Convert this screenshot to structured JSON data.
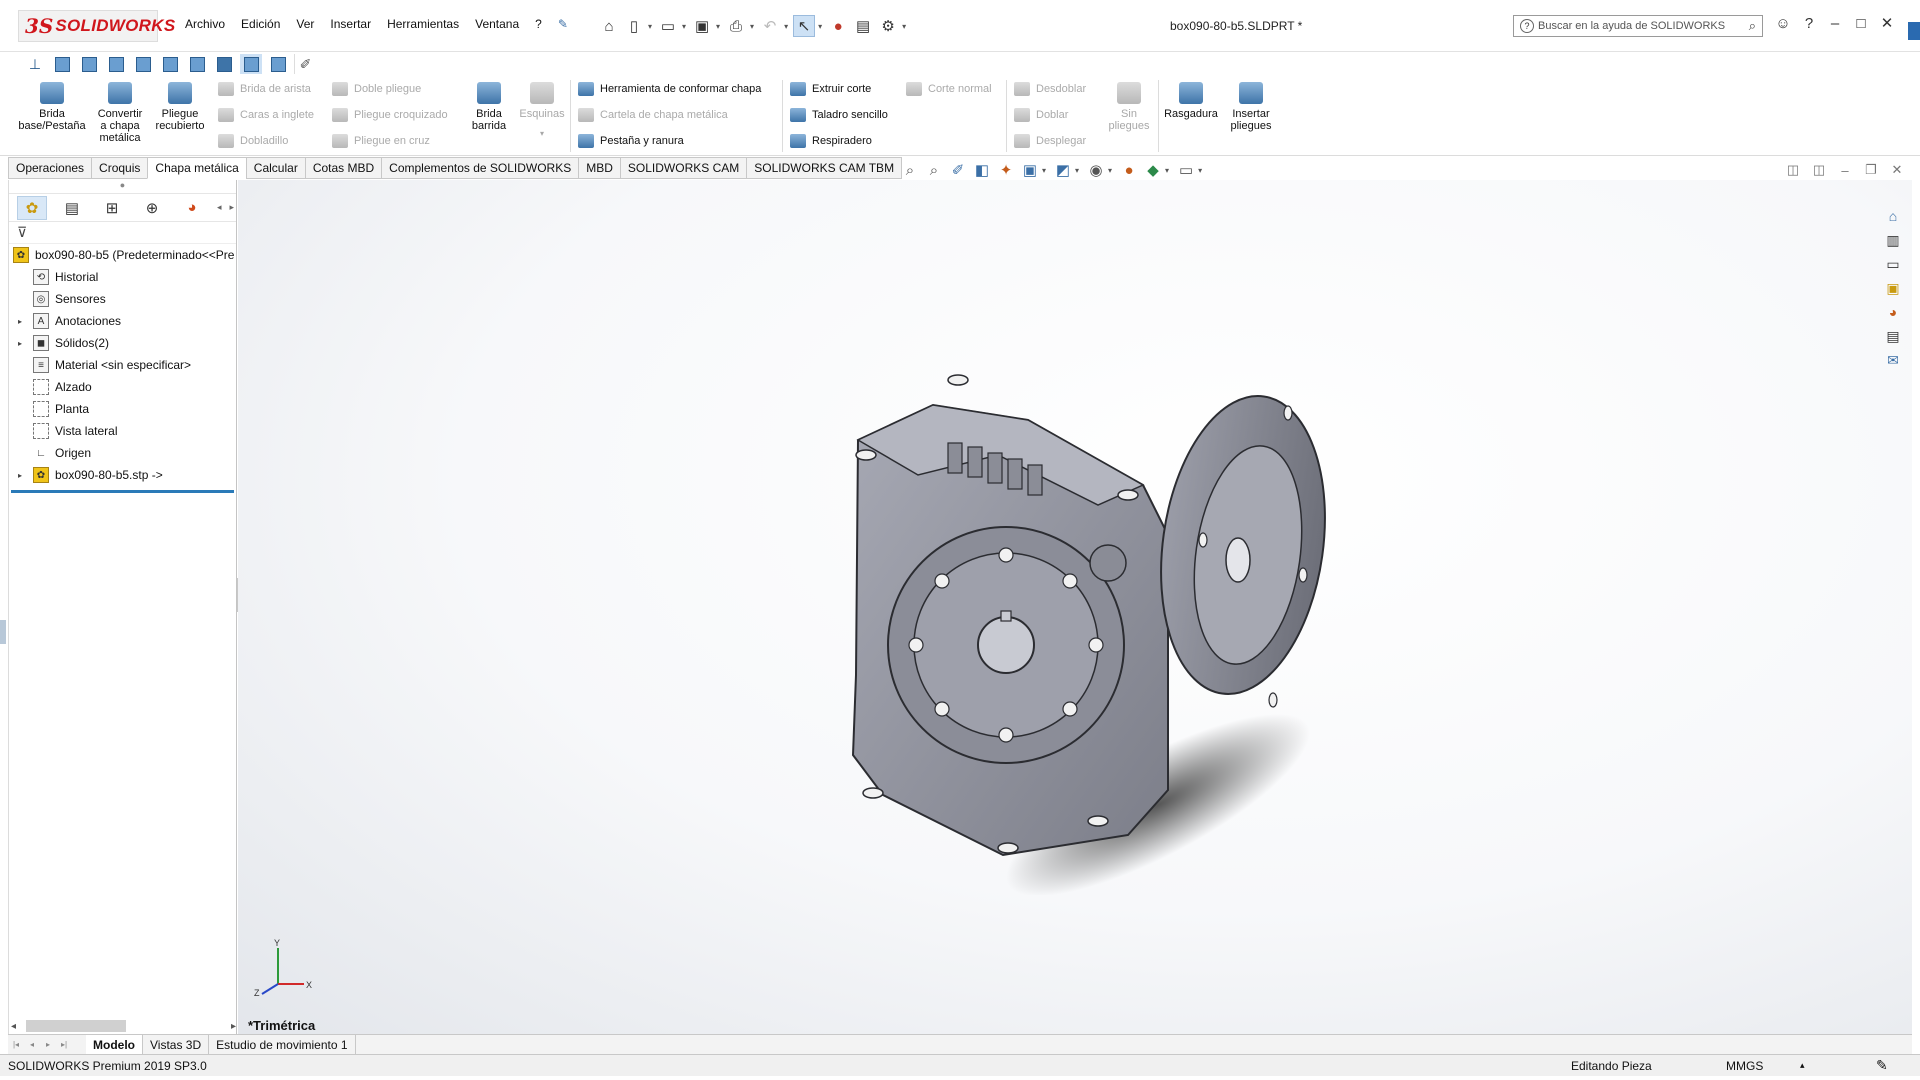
{
  "app": {
    "logo_ds": "3S",
    "logo_text": "SOLIDWORKS",
    "document_title": "box090-80-b5.SLDPRT *",
    "help_placeholder": "Buscar en la ayuda de SOLIDWORKS"
  },
  "menu": [
    "Archivo",
    "Edición",
    "Ver",
    "Insertar",
    "Herramientas",
    "Ventana",
    "?"
  ],
  "ribbon": {
    "brida_base": "Brida base/Pestaña",
    "convertir": "Convertir a chapa metálica",
    "pliegue_recubierto": "Pliegue recubierto",
    "brida_arista": "Brida de arista",
    "caras_inglete": "Caras a inglete",
    "dobladillo": "Dobladillo",
    "doble_pliegue": "Doble pliegue",
    "pliegue_croquizado": "Pliegue croquizado",
    "pliegue_cruz": "Pliegue en cruz",
    "brida_barrida": "Brida barrida",
    "esquinas": "Esquinas",
    "herramienta_conformar": "Herramienta de conformar chapa",
    "cartela": "Cartela de chapa metálica",
    "pestana_ranura": "Pestaña y ranura",
    "extruir_corte": "Extruir corte",
    "taladro_sencillo": "Taladro sencillo",
    "respiradero": "Respiradero",
    "corte_normal": "Corte normal",
    "desdoblar": "Desdoblar",
    "doblar": "Doblar",
    "desplegar": "Desplegar",
    "sin_pliegues": "Sin pliegues",
    "rasgadura": "Rasgadura",
    "insertar_pliegues": "Insertar pliegues"
  },
  "tabs": [
    "Operaciones",
    "Croquis",
    "Chapa metálica",
    "Calcular",
    "Cotas MBD",
    "Complementos de SOLIDWORKS",
    "MBD",
    "SOLIDWORKS CAM",
    "SOLIDWORKS CAM TBM"
  ],
  "active_tab": "Chapa metálica",
  "tree": {
    "root": "box090-80-b5  (Predeterminado<<Pre",
    "items": [
      {
        "label": "Historial"
      },
      {
        "label": "Sensores"
      },
      {
        "label": "Anotaciones"
      },
      {
        "label": "Sólidos(2)"
      },
      {
        "label": "Material <sin especificar>"
      },
      {
        "label": "Alzado"
      },
      {
        "label": "Planta"
      },
      {
        "label": "Vista lateral"
      },
      {
        "label": "Origen"
      },
      {
        "label": "box090-80-b5.stp ->"
      }
    ]
  },
  "viewport": {
    "view_name": "*Trimétrica",
    "triad_x": "X",
    "triad_y": "Y",
    "triad_z": "Z"
  },
  "bottom_tabs": [
    "Modelo",
    "Vistas 3D",
    "Estudio de movimiento 1"
  ],
  "status": {
    "version": "SOLIDWORKS Premium 2019 SP3.0",
    "mode": "Editando Pieza",
    "units": "MMGS"
  },
  "colors": {
    "brand_red": "#d0161c",
    "rollback_bar": "#2a7ab8",
    "model_gray": "#8c8e99"
  }
}
